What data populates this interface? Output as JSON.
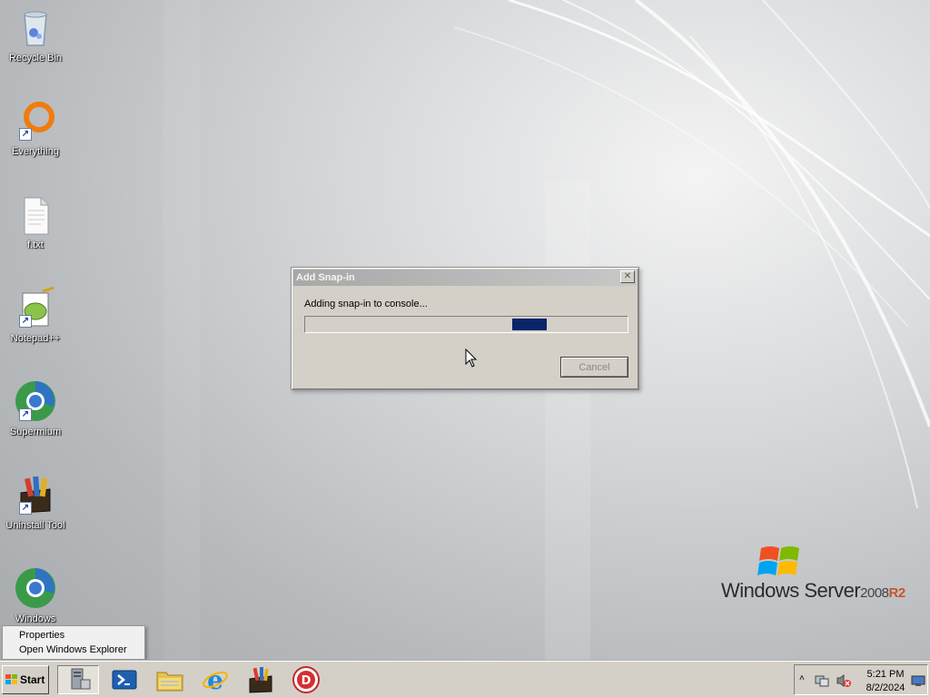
{
  "desktop": {
    "icons": [
      {
        "label": "Recycle Bin",
        "icon": "recycle-bin-icon"
      },
      {
        "label": "Everything",
        "icon": "everything-search-icon"
      },
      {
        "label": "f.txt",
        "icon": "text-file-icon"
      },
      {
        "label": "Notepad++",
        "icon": "notepad-plus-plus-icon"
      },
      {
        "label": "Supermium",
        "icon": "supermium-browser-icon"
      },
      {
        "label": "Uninstall Tool",
        "icon": "uninstall-tool-icon"
      },
      {
        "label": "Windows",
        "icon": "supermium-browser-icon"
      }
    ],
    "logo": {
      "brand": "Windows Server",
      "version": "2008",
      "edition": "R2"
    }
  },
  "dialog": {
    "title": "Add Snap-in",
    "close_label": "✕",
    "message": "Adding snap-in to console...",
    "cancel_label": "Cancel",
    "progress_chunk_position": 0.72,
    "progress_color": "#0a246a"
  },
  "context_menu": {
    "items": [
      {
        "label": "Properties"
      },
      {
        "label": "Open Windows Explorer"
      }
    ]
  },
  "taskbar": {
    "start_label": "Start",
    "pinned": [
      {
        "icon": "server-manager-icon",
        "active": true
      },
      {
        "icon": "powershell-icon"
      },
      {
        "icon": "windows-explorer-icon"
      },
      {
        "icon": "internet-explorer-icon"
      },
      {
        "icon": "uninstall-tool-icon"
      },
      {
        "icon": "red-d-app-icon"
      }
    ],
    "tray": {
      "chevron": "˄",
      "time": "5:21 PM",
      "date": "8/2/2024"
    }
  }
}
